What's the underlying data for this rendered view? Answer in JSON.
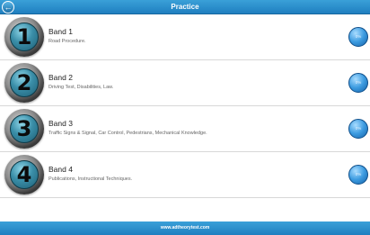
{
  "header": {
    "title": "Practice",
    "back_icon": "arrow-left-icon"
  },
  "bands": [
    {
      "number": "1",
      "title": "Band 1",
      "description": "Road Procedure.",
      "progress": "0%"
    },
    {
      "number": "2",
      "title": "Band 2",
      "description": "Driving Test, Disabilities, Law.",
      "progress": "0%"
    },
    {
      "number": "3",
      "title": "Band 3",
      "description": "Traffic Signs & Signal, Car Control, Pedestrians, Mechanical Knowledge.",
      "progress": "0%"
    },
    {
      "number": "4",
      "title": "Band 4",
      "description": "Publications, Instructional Techniques.",
      "progress": "0%"
    }
  ],
  "footer": {
    "url": "www.adtheorytest.com"
  },
  "colors": {
    "accent": "#2b8fd0",
    "badge_inner": "#3a8ea8",
    "progress": "#3c9be0"
  }
}
